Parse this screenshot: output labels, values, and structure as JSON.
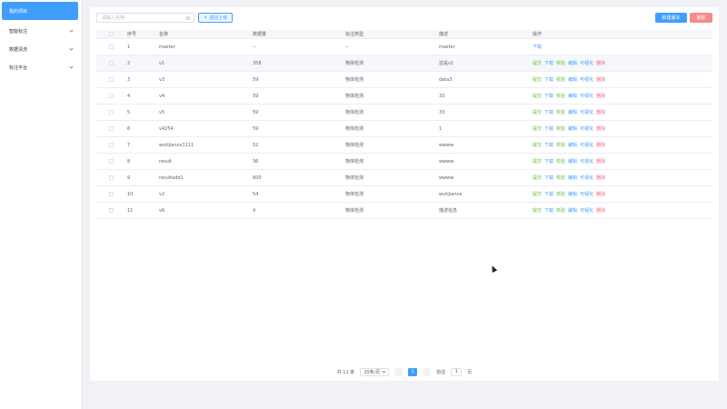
{
  "sidebar": {
    "items": [
      {
        "label": "我的项目",
        "active": true
      },
      {
        "label": "智能标注",
        "active": false
      },
      {
        "label": "数据清洗",
        "active": false
      },
      {
        "label": "标注平台",
        "active": false
      }
    ]
  },
  "toolbar": {
    "search_placeholder": "请输入名称",
    "return_label": "返回上级",
    "new_version_label": "新建版本",
    "delete_label": "删除"
  },
  "table": {
    "headers": [
      "序号",
      "名称",
      "数据量",
      "标注类型",
      "描述",
      "操作"
    ],
    "rows": [
      {
        "idx": "1",
        "name": "master",
        "count": "--",
        "type": "--",
        "desc": "master",
        "ops": [
          "下载"
        ]
      },
      {
        "idx": "2",
        "name": "v1",
        "count": "358",
        "type": "物体检测",
        "desc": "这是v1",
        "ops": [
          "提交",
          "下载",
          "校验",
          "编辑",
          "可视化",
          "删除"
        ]
      },
      {
        "idx": "3",
        "name": "v3",
        "count": "59",
        "type": "物体检测",
        "desc": "data3",
        "ops": [
          "提交",
          "下载",
          "校验",
          "编辑",
          "可视化",
          "删除"
        ]
      },
      {
        "idx": "4",
        "name": "v4",
        "count": "59",
        "type": "物体检测",
        "desc": "33",
        "ops": [
          "提交",
          "下载",
          "校验",
          "编辑",
          "可视化",
          "删除"
        ]
      },
      {
        "idx": "5",
        "name": "v5",
        "count": "59",
        "type": "物体检测",
        "desc": "33",
        "ops": [
          "提交",
          "下载",
          "校验",
          "编辑",
          "可视化",
          "删除"
        ]
      },
      {
        "idx": "6",
        "name": "v4254",
        "count": "59",
        "type": "物体检测",
        "desc": "1",
        "ops": [
          "提交",
          "下载",
          "校验",
          "编辑",
          "可视化",
          "删除"
        ]
      },
      {
        "idx": "7",
        "name": "wutijiance1111",
        "count": "52",
        "type": "物体检测",
        "desc": "wwww",
        "ops": [
          "提交",
          "下载",
          "校验",
          "编辑",
          "可视化",
          "删除"
        ]
      },
      {
        "idx": "8",
        "name": "result",
        "count": "36",
        "type": "物体检测",
        "desc": "wwww",
        "ops": [
          "提交",
          "下载",
          "校验",
          "编辑",
          "可视化",
          "删除"
        ]
      },
      {
        "idx": "9",
        "name": "resultadd1",
        "count": "600",
        "type": "物体检测",
        "desc": "wwww",
        "ops": [
          "提交",
          "下载",
          "校验",
          "编辑",
          "可视化",
          "删除"
        ]
      },
      {
        "idx": "10",
        "name": "v2",
        "count": "54",
        "type": "物体检测",
        "desc": "wutijiance",
        "ops": [
          "提交",
          "下载",
          "校验",
          "编辑",
          "可视化",
          "删除"
        ]
      },
      {
        "idx": "11",
        "name": "v6",
        "count": "4",
        "type": "物体检测",
        "desc": "描述信息",
        "ops": [
          "提交",
          "下载",
          "校验",
          "编辑",
          "可视化",
          "删除"
        ]
      }
    ]
  },
  "pagination": {
    "total": "共 11 条",
    "page_size": "20条/页",
    "prev": "‹",
    "next": "›",
    "current": "1",
    "goto_label": "前往",
    "goto_value": "1",
    "page_unit": "页"
  },
  "colors": {
    "primary": "#409eff",
    "danger": "#f56c6c",
    "success": "#67c23a"
  }
}
